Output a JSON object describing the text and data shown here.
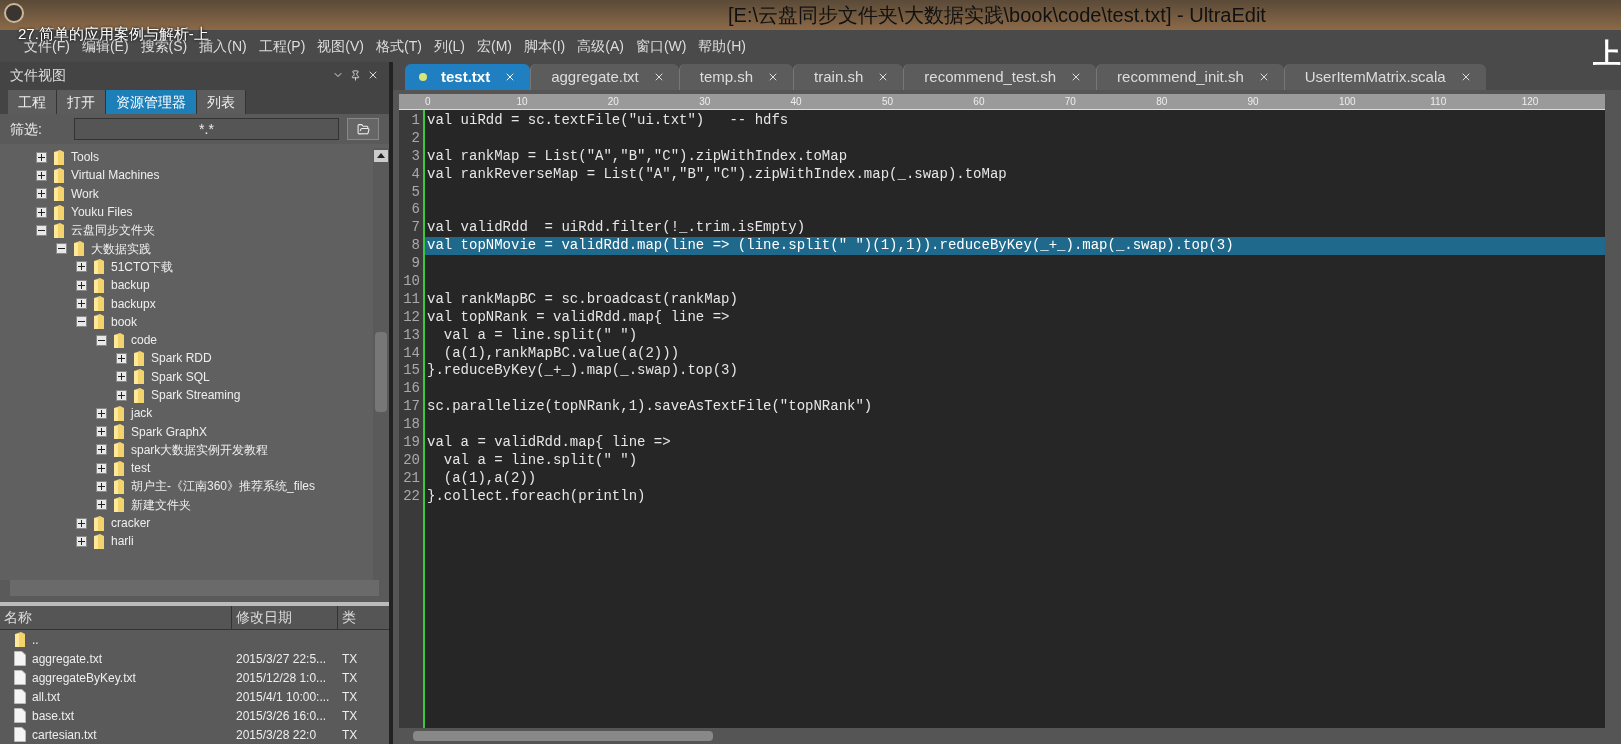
{
  "window": {
    "title": "[E:\\云盘同步文件夹\\大数据实践\\book\\code\\test.txt] - UltraEdit"
  },
  "video_overlay": {
    "title": "27.简单的应用案例与解析-上",
    "corner": "上"
  },
  "menu": [
    "文件(F)",
    "编辑(E)",
    "搜索(S)",
    "插入(N)",
    "工程(P)",
    "视图(V)",
    "格式(T)",
    "列(L)",
    "宏(M)",
    "脚本(I)",
    "高级(A)",
    "窗口(W)",
    "帮助(H)"
  ],
  "file_view": {
    "title": "文件视图",
    "tabs": [
      {
        "label": "工程",
        "selected": false
      },
      {
        "label": "打开",
        "selected": false
      },
      {
        "label": "资源管理器",
        "selected": true
      },
      {
        "label": "列表",
        "selected": false
      }
    ],
    "filter": {
      "label": "筛选:",
      "value": "*.*"
    },
    "tree": [
      {
        "label": "Tools",
        "expanded": false
      },
      {
        "label": "Virtual Machines",
        "expanded": false
      },
      {
        "label": "Work",
        "expanded": false
      },
      {
        "label": "Youku Files",
        "expanded": false
      },
      {
        "label": "云盘同步文件夹",
        "expanded": true,
        "children": [
          {
            "label": "大数据实践",
            "expanded": true,
            "children": [
              {
                "label": "51CTO下载",
                "expanded": false
              },
              {
                "label": "backup",
                "expanded": false
              },
              {
                "label": "backupx",
                "expanded": false
              },
              {
                "label": "book",
                "expanded": true,
                "children": [
                  {
                    "label": "code",
                    "expanded": true,
                    "children": [
                      {
                        "label": "Spark RDD",
                        "expanded": false
                      },
                      {
                        "label": "Spark SQL",
                        "expanded": false
                      },
                      {
                        "label": "Spark Streaming",
                        "expanded": false
                      }
                    ]
                  },
                  {
                    "label": "jack",
                    "expanded": false
                  },
                  {
                    "label": "Spark GraphX",
                    "expanded": false
                  },
                  {
                    "label": "spark大数据实例开发教程",
                    "expanded": false
                  },
                  {
                    "label": "test",
                    "expanded": false
                  },
                  {
                    "label": "胡户主-《江南360》推荐系统_files",
                    "expanded": false
                  },
                  {
                    "label": "新建文件夹",
                    "expanded": false
                  }
                ]
              },
              {
                "label": "cracker",
                "expanded": false
              },
              {
                "label": "harli",
                "expanded": false
              }
            ]
          }
        ]
      }
    ],
    "files": {
      "columns": [
        "名称",
        "修改日期",
        "类"
      ],
      "rows": [
        {
          "kind": "folder",
          "name": ".."
        },
        {
          "kind": "file",
          "name": "aggregate.txt",
          "date": "2015/3/27 22:5...",
          "type": "TX"
        },
        {
          "kind": "file",
          "name": "aggregateByKey.txt",
          "date": "2015/12/28 1:0...",
          "type": "TX"
        },
        {
          "kind": "file",
          "name": "all.txt",
          "date": "2015/4/1 10:00:...",
          "type": "TX"
        },
        {
          "kind": "file",
          "name": "base.txt",
          "date": "2015/3/26 16:0...",
          "type": "TX"
        },
        {
          "kind": "file",
          "name": "cartesian.txt",
          "date": "2015/3/28 22:0",
          "type": "TX"
        }
      ]
    }
  },
  "editor": {
    "tabs": [
      {
        "label": "test.txt",
        "selected": true,
        "modified": true
      },
      {
        "label": "aggregate.txt",
        "selected": false,
        "modified": false
      },
      {
        "label": "temp.sh",
        "selected": false,
        "modified": false
      },
      {
        "label": "train.sh",
        "selected": false,
        "modified": false
      },
      {
        "label": "recommend_test.sh",
        "selected": false,
        "modified": false
      },
      {
        "label": "recommend_init.sh",
        "selected": false,
        "modified": false
      },
      {
        "label": "UserItemMatrix.scala",
        "selected": false,
        "modified": false
      }
    ],
    "ruler": [
      "0",
      "10",
      "20",
      "30",
      "40",
      "50",
      "60",
      "70",
      "80",
      "90",
      "100",
      "110",
      "120"
    ],
    "lines": [
      {
        "number": "1",
        "text": "val uiRdd = sc.textFile(\"ui.txt\")   -- hdfs",
        "selected": false
      },
      {
        "number": "2",
        "selected": false
      },
      {
        "number": "3",
        "text": "val rankMap = List(\"A\",\"B\",\"C\").zipWithIndex.toMap",
        "selected": false
      },
      {
        "number": "4",
        "text": "val rankReverseMap = List(\"A\",\"B\",\"C\").zipWithIndex.map(_.swap).toMap",
        "selected": false
      },
      {
        "number": "5",
        "selected": false
      },
      {
        "number": "6",
        "selected": false
      },
      {
        "number": "7",
        "text": "val validRdd  = uiRdd.filter(!_.trim.isEmpty)",
        "selected": false
      },
      {
        "number": "8",
        "text": "val topNMovie = validRdd.map(line => (line.split(\" \")(1),1)).reduceByKey(_+_).map(_.swap).top(3)",
        "selected": true
      },
      {
        "number": "9",
        "selected": false
      },
      {
        "number": "10",
        "selected": false
      },
      {
        "number": "11",
        "text": "val rankMapBC = sc.broadcast(rankMap)",
        "selected": false
      },
      {
        "number": "12",
        "text": "val topNRank = validRdd.map{ line =>",
        "selected": false
      },
      {
        "number": "13",
        "text": "  val a = line.split(\" \")",
        "selected": false
      },
      {
        "number": "14",
        "text": "  (a(1),rankMapBC.value(a(2)))",
        "selected": false
      },
      {
        "number": "15",
        "text": "}.reduceByKey(_+_).map(_.swap).top(3)",
        "selected": false
      },
      {
        "number": "16",
        "selected": false
      },
      {
        "number": "17",
        "text": "sc.parallelize(topNRank,1).saveAsTextFile(\"topNRank\")",
        "selected": false
      },
      {
        "number": "18",
        "selected": false
      },
      {
        "number": "19",
        "text": "val a = validRdd.map{ line =>",
        "selected": false
      },
      {
        "number": "20",
        "text": "  val a = line.split(\" \")",
        "selected": false
      },
      {
        "number": "21",
        "text": "  (a(1),a(2))",
        "selected": false
      },
      {
        "number": "22",
        "text": "}.collect.foreach(println)",
        "selected": false
      }
    ]
  }
}
